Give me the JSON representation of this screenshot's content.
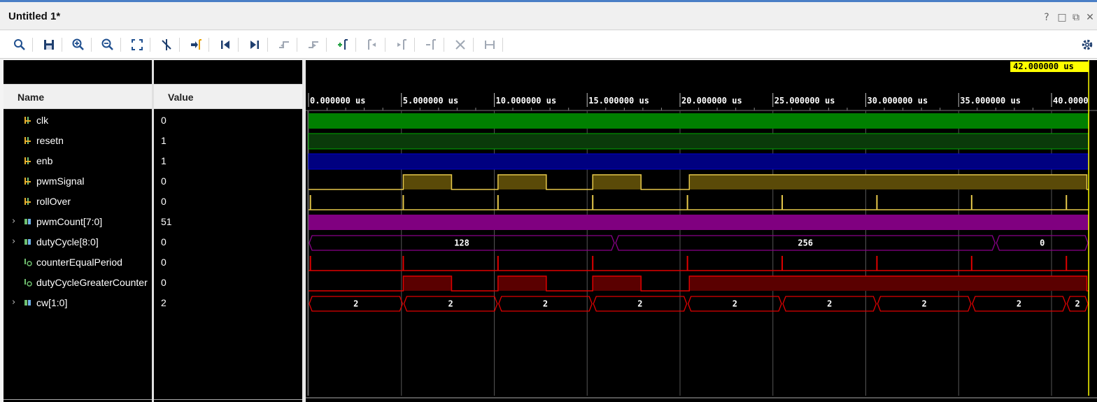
{
  "window": {
    "title": "Untitled 1*",
    "controls": [
      "?",
      "□",
      "⧉",
      "✕"
    ]
  },
  "toolbar": {
    "buttons": [
      "search-icon",
      "save-icon",
      "zoom-in-icon",
      "zoom-out-icon",
      "zoom-fit-icon",
      "cursor-snap-icon",
      "go-to-cursor-icon",
      "go-to-start-icon",
      "go-to-end-icon",
      "previous-transition-icon",
      "next-transition-icon",
      "add-marker-icon",
      "previous-marker-icon",
      "next-marker-icon",
      "swap-cursors-icon",
      "delete-marker-icon",
      "marker-distance-icon",
      "settings-icon"
    ]
  },
  "columns": {
    "name": "Name",
    "value": "Value"
  },
  "signals": [
    {
      "name": "clk",
      "value": "0",
      "kind": "bit",
      "expandable": false
    },
    {
      "name": "resetn",
      "value": "1",
      "kind": "bit",
      "expandable": false
    },
    {
      "name": "enb",
      "value": "1",
      "kind": "bit",
      "expandable": false
    },
    {
      "name": "pwmSignal",
      "value": "0",
      "kind": "bit",
      "expandable": false
    },
    {
      "name": "rollOver",
      "value": "0",
      "kind": "bit",
      "expandable": false
    },
    {
      "name": "pwmCount[7:0]",
      "value": "51",
      "kind": "bus",
      "expandable": true
    },
    {
      "name": "dutyCycle[8:0]",
      "value": "0",
      "kind": "bus",
      "expandable": true
    },
    {
      "name": "counterEqualPeriod",
      "value": "0",
      "kind": "internal",
      "expandable": false
    },
    {
      "name": "dutyCycleGreaterCounter",
      "value": "0",
      "kind": "internal",
      "expandable": false
    },
    {
      "name": "cw[1:0]",
      "value": "2",
      "kind": "bus",
      "expandable": true
    }
  ],
  "timeline": {
    "cursor_label": "42.000000 us",
    "cursor_time_us": 42.0,
    "ticks": [
      "0.000000 us",
      "5.000000 us",
      "10.000000 us",
      "15.000000 us",
      "20.000000 us",
      "25.000000 us",
      "30.000000 us",
      "35.000000 us",
      "40.0000"
    ],
    "tick_values_us": [
      0,
      5,
      10,
      15,
      20,
      25,
      30,
      35,
      40
    ],
    "view_end_us": 42.0
  },
  "waves": {
    "clk": {
      "style": "dense",
      "color": "#008000"
    },
    "resetn": {
      "style": "high",
      "color": "#00aa00",
      "fill": "#0a3a0a"
    },
    "enb": {
      "style": "high",
      "color": "#0000cc",
      "fill": "#000080"
    },
    "pwmSignal": {
      "color": "#e6c84a",
      "fill": "#5a4a08",
      "high_intervals_us": [
        [
          5.1,
          7.7
        ],
        [
          10.2,
          12.8
        ],
        [
          15.3,
          17.9
        ],
        [
          20.5,
          41.9
        ]
      ]
    },
    "rollOver": {
      "color": "#e6c84a",
      "pulses_us": [
        0.1,
        5.1,
        10.2,
        15.3,
        20.4,
        25.5,
        30.6,
        35.7,
        40.8
      ]
    },
    "pwmCount": {
      "style": "dense",
      "color": "#a000a0",
      "fill": "#800080"
    },
    "dutyCycle": {
      "color": "#8a008a",
      "segments": [
        {
          "start": 0.0,
          "end": 16.5,
          "label": "128"
        },
        {
          "start": 16.5,
          "end": 37.0,
          "label": "256"
        },
        {
          "start": 37.0,
          "end": 42.0,
          "label": "0"
        }
      ]
    },
    "counterEqualPeriod": {
      "color": "#e00000",
      "pulses_us": [
        0.1,
        5.1,
        10.2,
        15.3,
        20.4,
        25.5,
        30.6,
        35.7,
        40.8
      ]
    },
    "dutyCycleGreaterCounter": {
      "color": "#e00000",
      "fill": "#5a0000",
      "high_intervals_us": [
        [
          5.1,
          7.7
        ],
        [
          10.2,
          12.8
        ],
        [
          15.3,
          17.9
        ],
        [
          20.5,
          41.9
        ]
      ]
    },
    "cw": {
      "color": "#e00000",
      "segments": [
        {
          "start": 0.0,
          "end": 5.1,
          "label": "2"
        },
        {
          "start": 5.1,
          "end": 10.2,
          "label": "2"
        },
        {
          "start": 10.2,
          "end": 15.3,
          "label": "2"
        },
        {
          "start": 15.3,
          "end": 20.4,
          "label": "2"
        },
        {
          "start": 20.4,
          "end": 25.5,
          "label": "2"
        },
        {
          "start": 25.5,
          "end": 30.6,
          "label": "2"
        },
        {
          "start": 30.6,
          "end": 35.7,
          "label": "2"
        },
        {
          "start": 35.7,
          "end": 40.8,
          "label": "2"
        },
        {
          "start": 40.8,
          "end": 42.0,
          "label": "2"
        }
      ]
    }
  }
}
